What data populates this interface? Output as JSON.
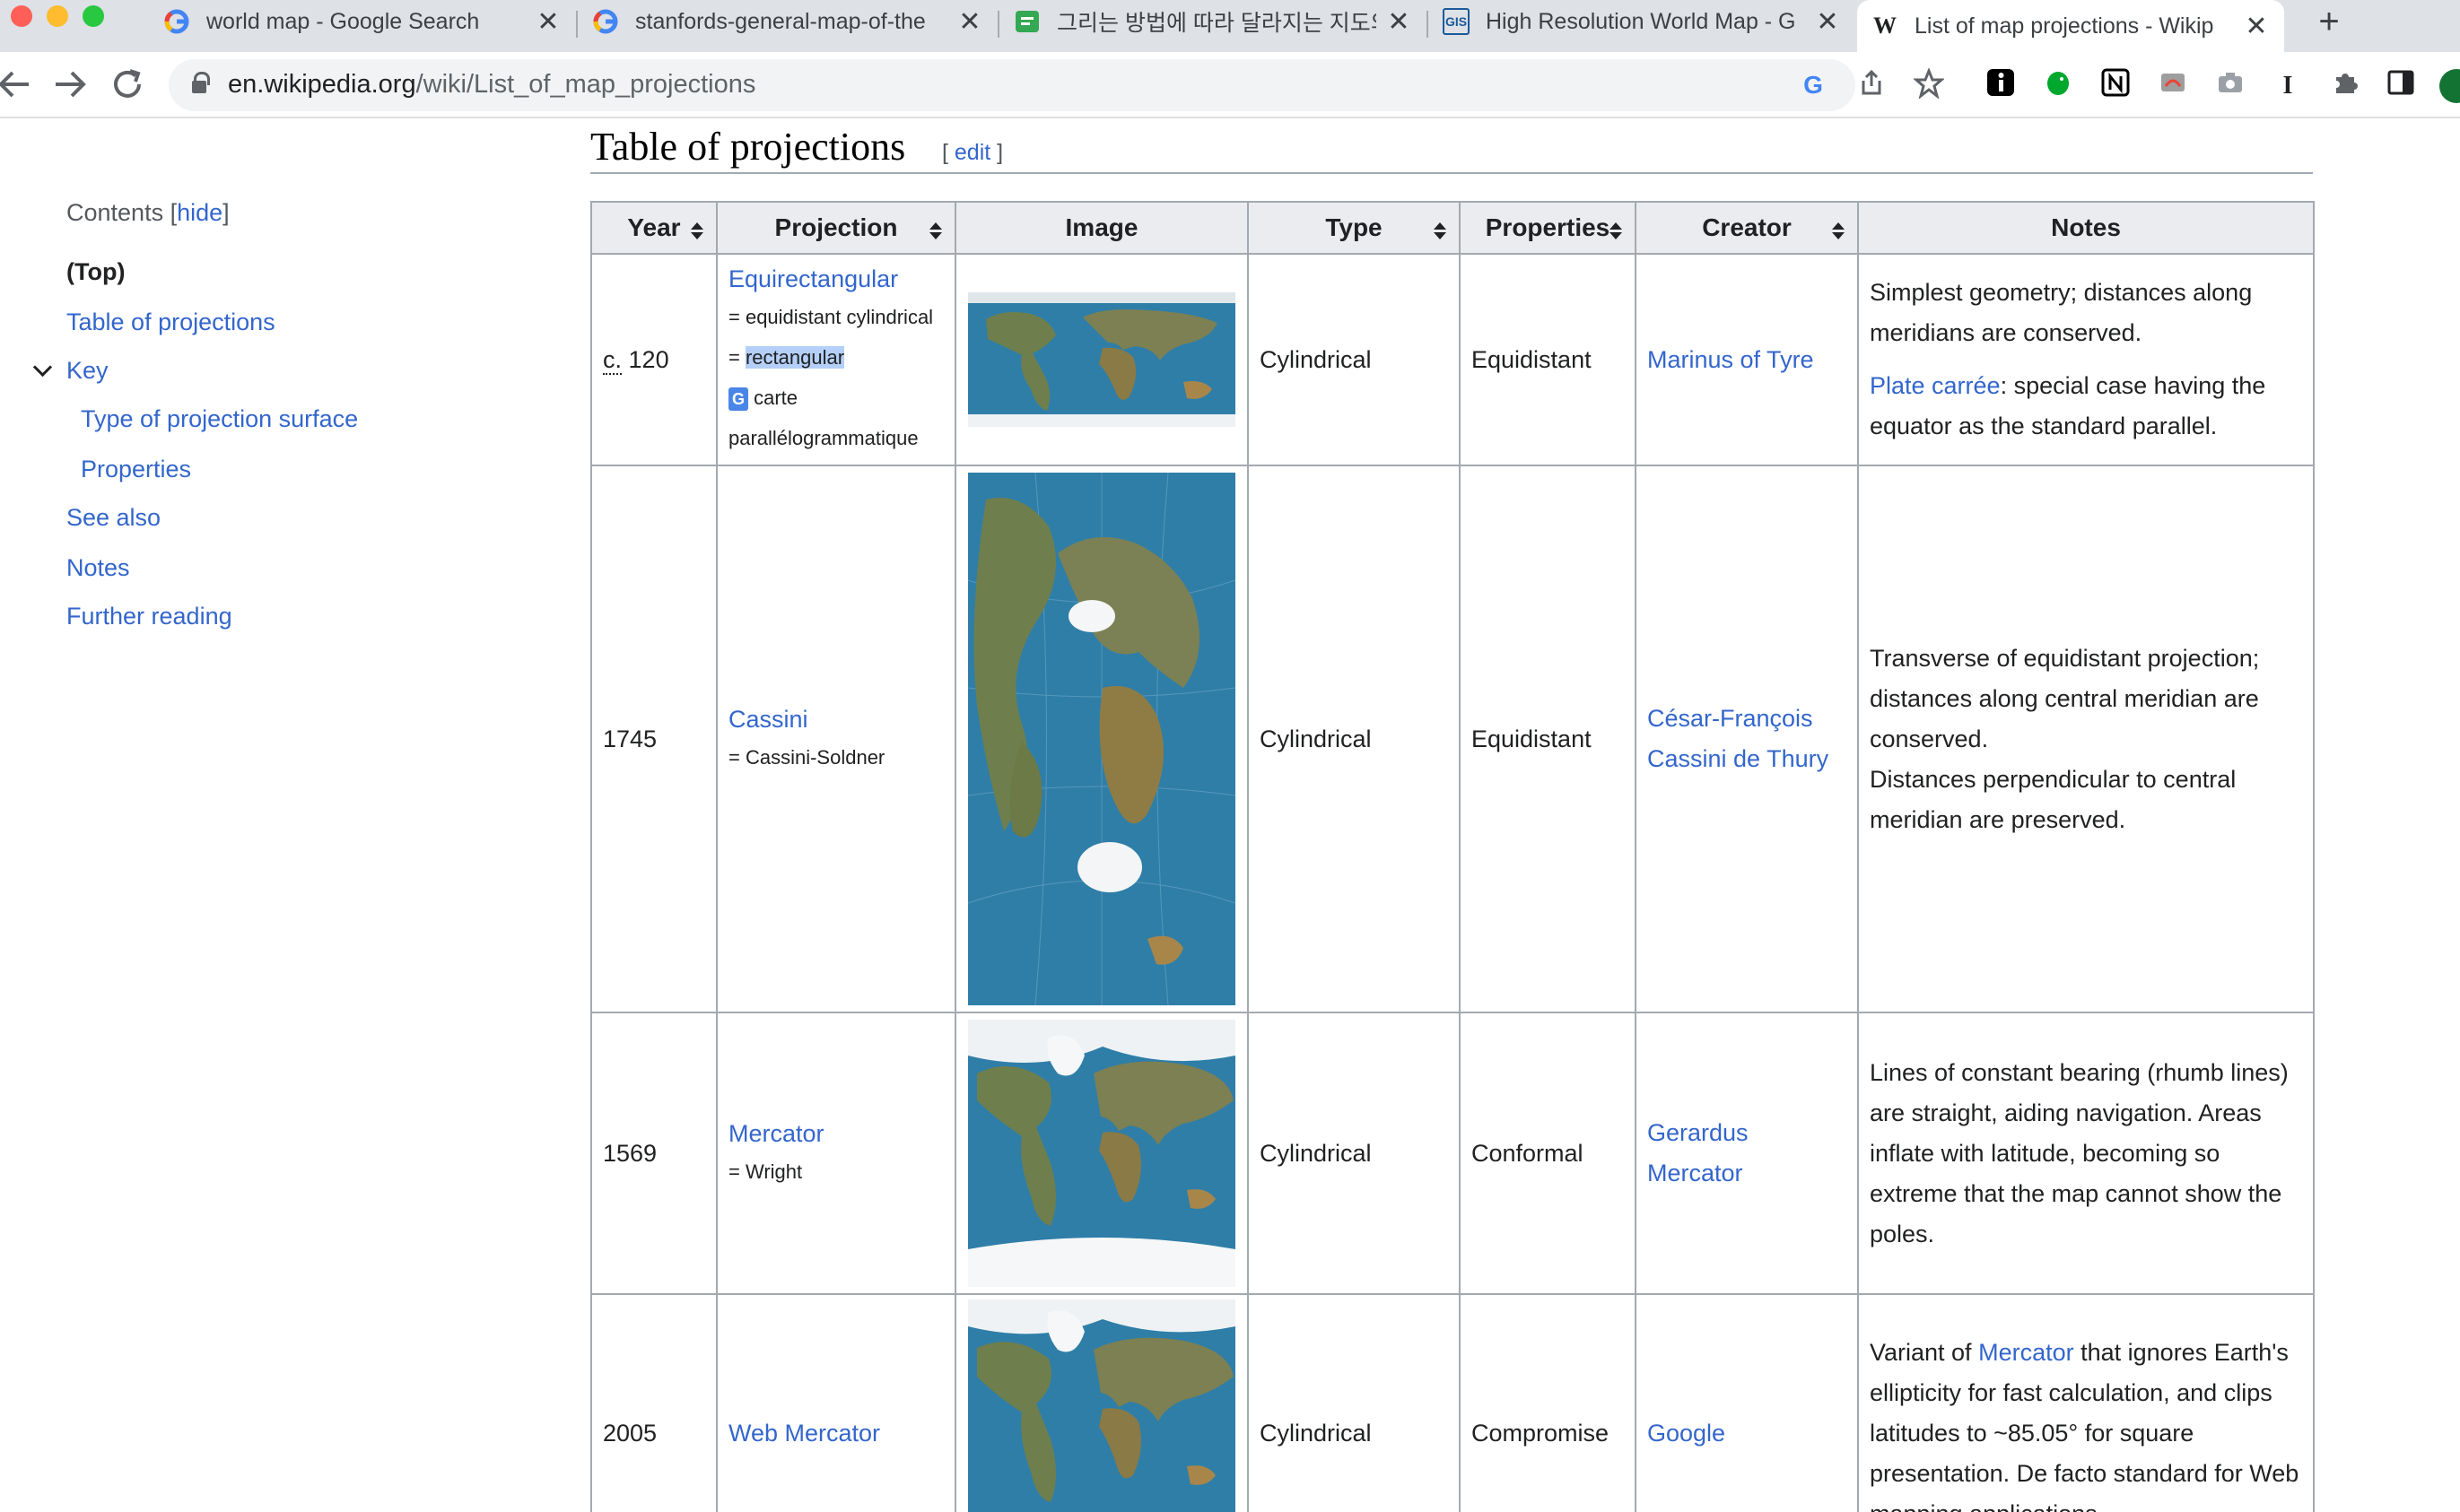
{
  "browser": {
    "tabs": [
      {
        "title": "world map - Google Search",
        "favicon": "google-icon",
        "active": false
      },
      {
        "title": "stanfords-general-map-of-the",
        "favicon": "google-icon",
        "active": false
      },
      {
        "title": "그리는 방법에 따라 달라지는 지도의",
        "favicon": "chat-icon",
        "active": false
      },
      {
        "title": "High Resolution World Map - G",
        "favicon": "gis-icon",
        "favicon_text": "GIS",
        "active": false
      },
      {
        "title": "List of map projections - Wikip",
        "favicon": "wikipedia-icon",
        "favicon_text": "W",
        "active": true
      }
    ],
    "close_glyph": "✕",
    "new_tab_glyph": "+",
    "url_domain": "en.wikipedia.org",
    "url_path": "/wiki/List_of_map_projections",
    "google_glyph": "G"
  },
  "sidebar": {
    "contents_label": "Contents",
    "hide_link": "hide",
    "items": [
      {
        "label": "(Top)"
      },
      {
        "label": "Table of projections"
      },
      {
        "label": "Key"
      },
      {
        "label": "Type of projection surface"
      },
      {
        "label": "Properties"
      },
      {
        "label": "See also"
      },
      {
        "label": "Notes"
      },
      {
        "label": "Further reading"
      }
    ]
  },
  "main": {
    "heading": "Table of projections",
    "edit_link": "edit",
    "columns": [
      "Year",
      "Projection",
      "Image",
      "Type",
      "Properties",
      "Creator",
      "Notes"
    ],
    "rows": [
      {
        "year_prefix": "c.",
        "year": "120",
        "projection": "Equirectangular",
        "aliases": [
          "= equidistant cylindrical",
          "= ",
          "rectangular",
          "carte",
          "parallélogrammatique"
        ],
        "type": "Cylindrical",
        "properties": "Equidistant",
        "creator": "Marinus of Tyre",
        "notes_1": "Simplest geometry; distances along meridians are conserved.",
        "notes_link": "Plate carrée",
        "notes_2": ": special case having the equator as the standard parallel."
      },
      {
        "year": "1745",
        "projection": "Cassini",
        "alias": "= Cassini-Soldner",
        "type": "Cylindrical",
        "properties": "Equidistant",
        "creator": "César-François Cassini de Thury",
        "notes_1": "Transverse of equidistant projection; distances along central meridian are conserved.",
        "notes_2": "Distances perpendicular to central meridian are preserved."
      },
      {
        "year": "1569",
        "projection": "Mercator",
        "alias": "= Wright",
        "type": "Cylindrical",
        "properties": "Conformal",
        "creator": "Gerardus Mercator",
        "notes_1": "Lines of constant bearing (rhumb lines) are straight, aiding navigation. Areas inflate with latitude, becoming so extreme that the map cannot show the poles."
      },
      {
        "year": "2005",
        "projection": "Web Mercator",
        "type": "Cylindrical",
        "properties": "Compromise",
        "creator": "Google",
        "notes_pre": "Variant of ",
        "notes_link": "Mercator",
        "notes_post": " that ignores Earth's ellipticity for fast calculation, and clips latitudes to ~85.05° for square presentation. De facto standard for Web mapping applications."
      }
    ]
  },
  "colors": {
    "link": "#3366cc",
    "header_bg": "#eaecf0",
    "border": "#a2a9b1",
    "ocean": "#2f7ea8"
  }
}
